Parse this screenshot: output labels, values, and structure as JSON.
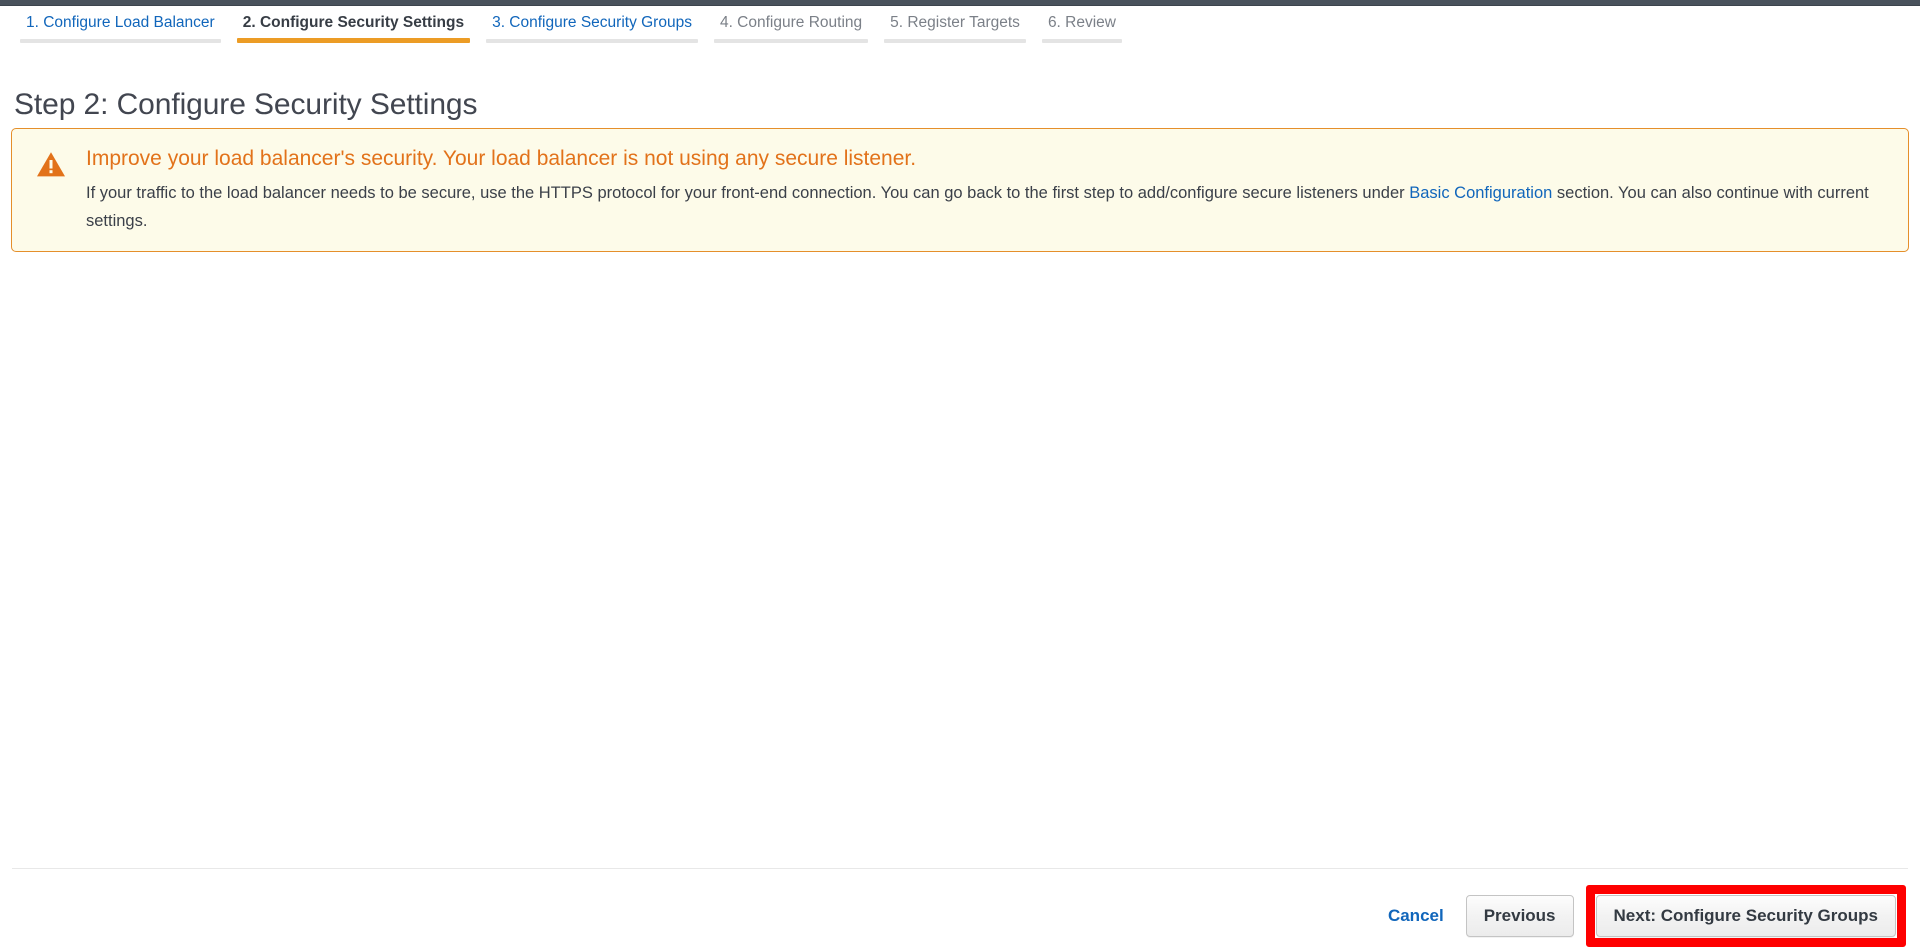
{
  "wizard": {
    "steps": [
      {
        "label": "1. Configure Load Balancer",
        "state": "done"
      },
      {
        "label": "2. Configure Security Settings",
        "state": "active"
      },
      {
        "label": "3. Configure Security Groups",
        "state": "done"
      },
      {
        "label": "4. Configure Routing",
        "state": "future"
      },
      {
        "label": "5. Register Targets",
        "state": "future"
      },
      {
        "label": "6. Review",
        "state": "future"
      }
    ]
  },
  "page": {
    "title": "Step 2: Configure Security Settings"
  },
  "alert": {
    "icon": "warning-triangle-icon",
    "heading": "Improve your load balancer's security. Your load balancer is not using any secure listener.",
    "body_before_link": "If your traffic to the load balancer needs to be secure, use the HTTPS protocol for your front-end connection. You can go back to the first step to add/configure secure listeners under",
    "link_text": "Basic Configuration",
    "body_after_link": "section. You can also continue with current settings.",
    "border_color": "#e58f2b",
    "background_color": "#fdfbe9",
    "heading_color": "#e2721a"
  },
  "footer": {
    "cancel_label": "Cancel",
    "previous_label": "Previous",
    "next_label": "Next: Configure Security Groups",
    "highlight_color": "#fe0000"
  }
}
